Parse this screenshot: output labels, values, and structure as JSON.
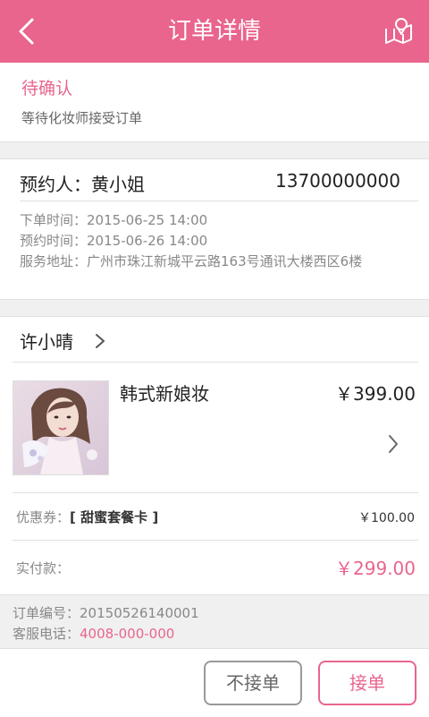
{
  "header": {
    "title": "订单详情",
    "back_icon": "chevron-left-icon",
    "map_icon": "map-pin-icon"
  },
  "status": {
    "title": "待确认",
    "subtitle": "等待化妆师接受订单"
  },
  "booking": {
    "contact_label": "预约人：",
    "contact_name": "黄小姐",
    "phone": "13700000000",
    "order_time_label": "下单时间：",
    "order_time": "2015-06-25 14:00",
    "appointment_time_label": "预约时间：",
    "appointment_time": "2015-06-26 14:00",
    "address_label": "服务地址：",
    "address": "广州市珠江新城平云路163号通讯大楼西区6楼"
  },
  "artist": {
    "name": "许小晴"
  },
  "product": {
    "name": "韩式新娘妆",
    "price": "￥399.00",
    "coupon_label": "优惠券：",
    "coupon_name": "[ 甜蜜套餐卡 ]",
    "coupon_value": "￥100.00",
    "paid_label": "实付款：",
    "paid_value": "￥299.00"
  },
  "info": {
    "order_no_label": "订单编号：",
    "order_no": "20150526140001",
    "service_phone_label": "客服电话：",
    "service_phone": "4008-000-000"
  },
  "actions": {
    "reject_label": "不接单",
    "accept_label": "接单"
  },
  "colors": {
    "accent": "#e9658d",
    "background": "#f0f0f0"
  }
}
